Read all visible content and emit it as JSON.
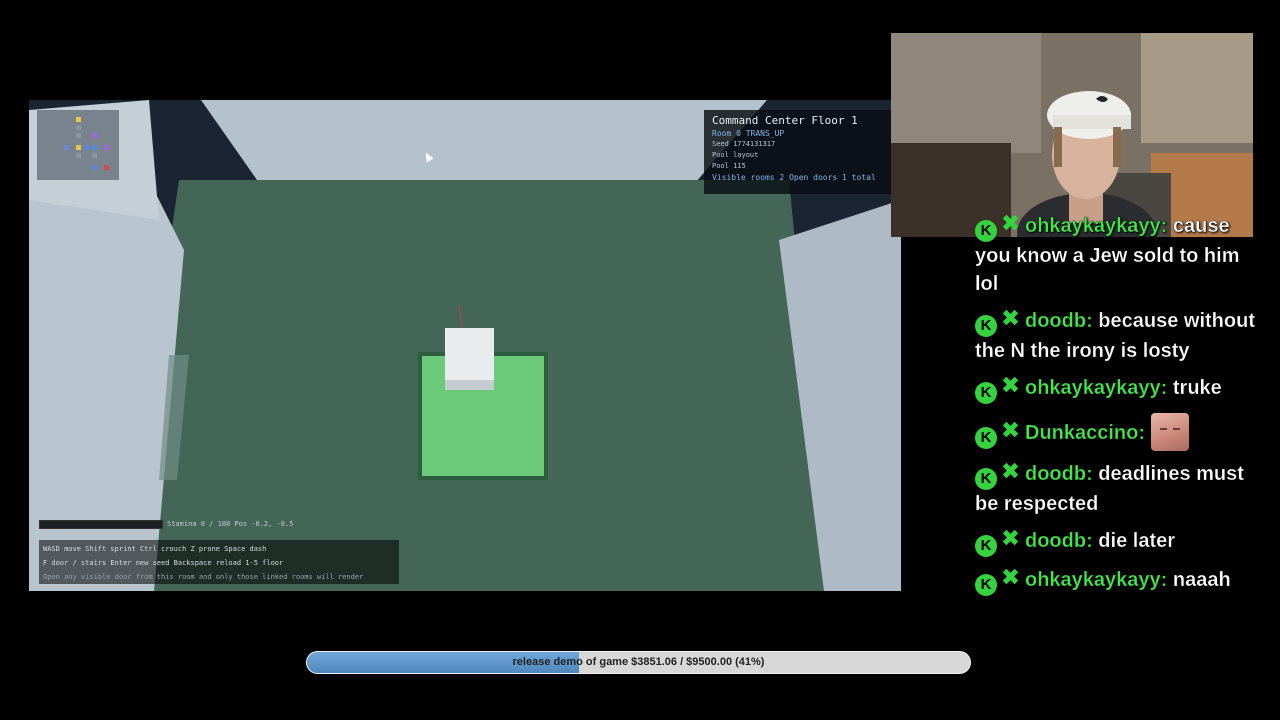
{
  "room_hud": {
    "title": "Command Center  Floor 1",
    "room": "Room 0  TRANS_UP",
    "seed": "Seed 1774131317",
    "pool_layout": "Pool layout",
    "pool": "Pool 115",
    "visible": "Visible rooms 2   Open doors 1 total"
  },
  "status": {
    "stamina_pos": "Stamina 0 / 100   Pos -0.2, -0.5",
    "stamina_fraction": 0
  },
  "controls": {
    "line1": "WASD move  Shift sprint  Ctrl crouch  Z prone  Space dash",
    "line2": "F door / stairs  Enter new seed  Backspace reload  1-5 floor",
    "line3": "Open any visible door from this room and only those linked rooms will render"
  },
  "chat": [
    {
      "user": "ohkaykaykayy",
      "text": "cause you know a Jew sold to him lol"
    },
    {
      "user": "doodb",
      "text": "because without the N the irony is losty"
    },
    {
      "user": "ohkaykaykayy",
      "text": "truke"
    },
    {
      "user": "Dunkaccino",
      "text": "",
      "emote": "face-emote"
    },
    {
      "user": "doodb",
      "text": "deadlines must be respected"
    },
    {
      "user": "doodb",
      "text": "die later"
    },
    {
      "user": "ohkaykaykayy",
      "text": "naaah"
    }
  ],
  "chat_badge_letter": "K",
  "goal": {
    "label": "release demo of game $3851.06 / $9500.00 (41%)",
    "fraction": 0.41
  },
  "colors": {
    "floor": "#446656",
    "pad": "#6ccb7a",
    "chat_user": "#40e849",
    "badge": "#34d33f",
    "goal_fill": "#5b95c9"
  }
}
